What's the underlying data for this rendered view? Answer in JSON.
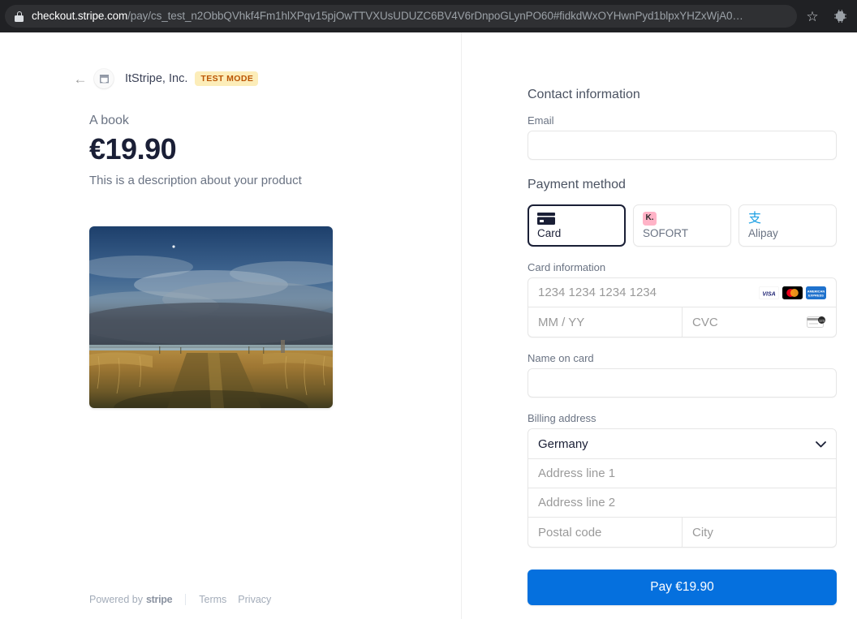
{
  "browser": {
    "url_domain": "checkout.stripe.com",
    "url_path": "/pay/cs_test_n2ObbQVhkf4Fm1hlXPqv15pjOwTTVXUsUDUZC6BV4V6rDnpoGLynPO60#fidkdWxOYHwnPyd1blpxYHZxWjA0…",
    "lock_icon": "lock-icon",
    "bookmark_icon": "☆",
    "extension_icon": "⬚"
  },
  "left": {
    "back_icon": "←",
    "store_icon": "store-icon",
    "merchant_name": "ItStripe, Inc.",
    "test_badge": "TEST MODE",
    "product_name": "A book",
    "product_price": "€19.90",
    "product_description": "This is a description about your product",
    "product_image_alt": "grass field under cloudy sky at sunset",
    "footer": {
      "powered_by": "Powered by",
      "stripe": "stripe",
      "terms": "Terms",
      "privacy": "Privacy"
    }
  },
  "right": {
    "contact_title": "Contact information",
    "email_label": "Email",
    "email_value": "",
    "payment_method_title": "Payment method",
    "payment_methods": [
      {
        "label": "Card",
        "icon": "credit-card-icon",
        "selected": true
      },
      {
        "label": "SOFORT",
        "icon": "klarna-icon",
        "badge_text": "K.",
        "selected": false
      },
      {
        "label": "Alipay",
        "icon": "alipay-icon",
        "glyph": "支",
        "selected": false
      }
    ],
    "card_information_label": "Card information",
    "card_number_placeholder": "1234 1234 1234 1234",
    "card_expiry_placeholder": "MM / YY",
    "card_cvc_placeholder": "CVC",
    "card_brands": [
      "visa",
      "mastercard",
      "amex"
    ],
    "cvc_hint_icon": "card-back-cvc-icon",
    "name_on_card_label": "Name on card",
    "name_on_card_value": "",
    "billing_address_label": "Billing address",
    "country_value": "Germany",
    "country_chevron": "⌄",
    "address_line1_placeholder": "Address line 1",
    "address_line2_placeholder": "Address line 2",
    "postal_code_placeholder": "Postal code",
    "city_placeholder": "City",
    "pay_button_label": "Pay €19.90"
  },
  "colors": {
    "accent": "#0570de",
    "badge_bg": "#fcedb9",
    "badge_text": "#bb5504",
    "klarna_pink": "#ffb3c7",
    "alipay_blue": "#1da0e3",
    "text_dark": "#1a1f36",
    "text_muted": "#6a7383"
  }
}
